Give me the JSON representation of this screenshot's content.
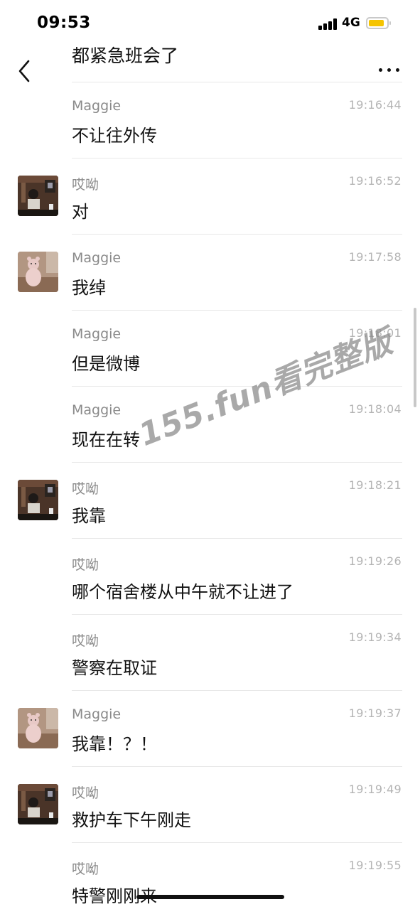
{
  "status_bar": {
    "time": "09:53",
    "network": "4G"
  },
  "header": {
    "top_message": "都紧急班会了"
  },
  "messages": [
    {
      "sender": "Maggie",
      "time": "19:16:44",
      "text": "不让往外传",
      "avatar": "none"
    },
    {
      "sender": "哎呦",
      "time": "19:16:52",
      "text": "对",
      "avatar": "a"
    },
    {
      "sender": "Maggie",
      "time": "19:17:58",
      "text": "我绰",
      "avatar": "b"
    },
    {
      "sender": "Maggie",
      "time": "19:18:01",
      "text": "但是微博",
      "avatar": "none"
    },
    {
      "sender": "Maggie",
      "time": "19:18:04",
      "text": "现在在转",
      "avatar": "none"
    },
    {
      "sender": "哎呦",
      "time": "19:18:21",
      "text": "我靠",
      "avatar": "a"
    },
    {
      "sender": "哎呦",
      "time": "19:19:26",
      "text": "哪个宿舍楼从中午就不让进了",
      "avatar": "none"
    },
    {
      "sender": "哎呦",
      "time": "19:19:34",
      "text": "警察在取证",
      "avatar": "none"
    },
    {
      "sender": "Maggie",
      "time": "19:19:37",
      "text": "我靠！？！",
      "avatar": "b"
    },
    {
      "sender": "哎呦",
      "time": "19:19:49",
      "text": "救护车下午刚走",
      "avatar": "a"
    },
    {
      "sender": "哎呦",
      "time": "19:19:55",
      "text": "特警刚刚来",
      "avatar": "none"
    }
  ],
  "watermark": "155.fun看完整版",
  "icons": {
    "back": "chevron-left-icon",
    "more": "more-dots-icon",
    "signal": "signal-icon",
    "battery": "battery-icon"
  },
  "colors": {
    "battery_fill": "#f5c400",
    "sender": "#8a8a8a",
    "timestamp": "#b4b4b4"
  }
}
